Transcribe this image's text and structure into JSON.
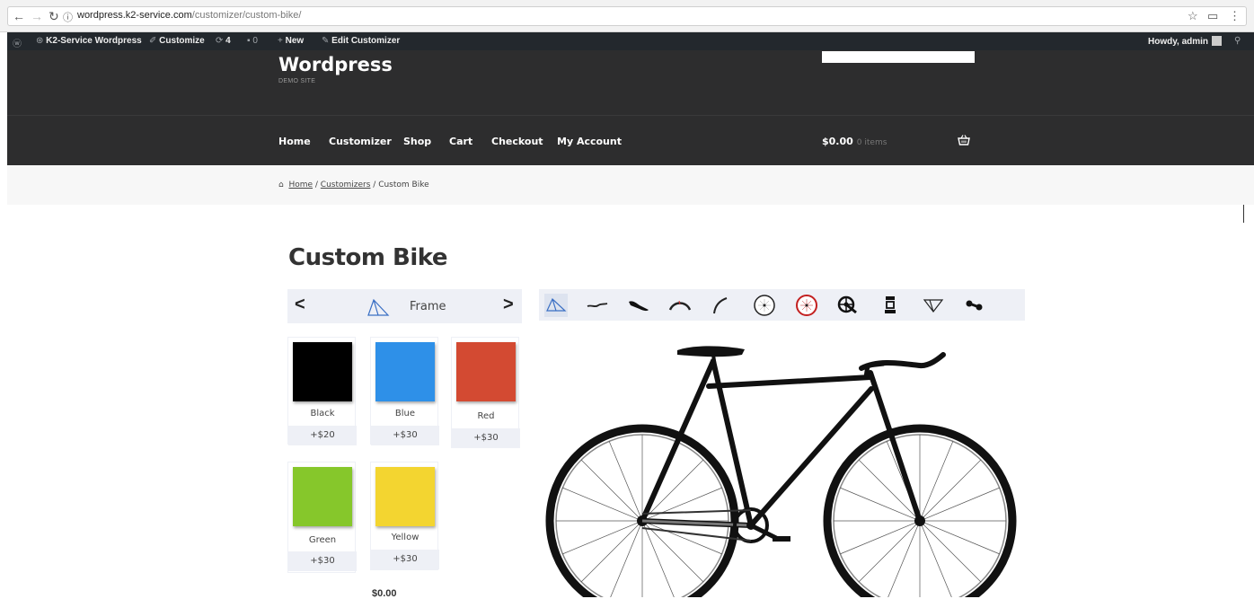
{
  "browser": {
    "url_host": "wordpress.k2-service.com",
    "url_path": "/customizer/custom-bike/",
    "back_icon": "arrow-left-icon",
    "forward_icon": "arrow-right-icon",
    "reload_icon": "reload-icon",
    "info_icon": "info-icon"
  },
  "adminbar": {
    "site_name": "K2-Service Wordpress",
    "customize": "Customize",
    "updates": "4",
    "comments": "0",
    "new": "New",
    "edit": "Edit Customizer",
    "howdy": "Howdy, admin"
  },
  "header": {
    "title": "Wordpress",
    "description": "DEMO SITE",
    "nav": [
      "Home",
      "Customizer",
      "Shop",
      "Cart",
      "Checkout",
      "My Account"
    ],
    "cart_total": "$0.00",
    "cart_count": "0 items"
  },
  "breadcrumb": {
    "home": "Home",
    "sep1": " / ",
    "customizers": "Customizers",
    "current": " / Custom Bike"
  },
  "product": {
    "title": "Custom Bike",
    "step_label": "Frame",
    "prev_arrow": "<",
    "next_arrow": ">",
    "components": [
      "frame-icon",
      "handlebar-icon",
      "saddle-icon",
      "fender-icon",
      "fork-icon",
      "front-wheel-icon",
      "rear-wheel-icon",
      "crankset-icon",
      "pedal-icon",
      "seat-stay-icon",
      "chain-icon"
    ],
    "swatches": [
      {
        "name": "Black",
        "price": "+$20",
        "color": "#000000"
      },
      {
        "name": "Blue",
        "price": "+$30",
        "color": "#2e90e8"
      },
      {
        "name": "Red",
        "price": "+$30",
        "color": "#d34a32"
      },
      {
        "name": "Green",
        "price": "+$30",
        "color": "#86c72b"
      },
      {
        "name": "Yellow",
        "price": "+$30",
        "color": "#f3d530"
      }
    ],
    "bottom_price": "$0.00"
  }
}
